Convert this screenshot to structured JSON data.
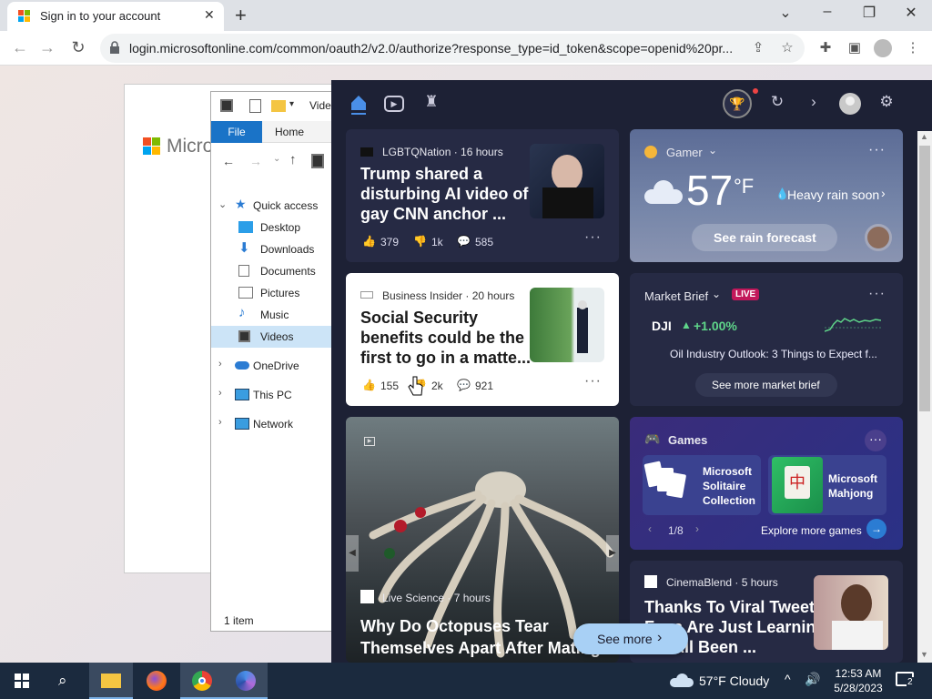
{
  "browser": {
    "tab_title": "Sign in to your account",
    "url": "login.microsoftonline.com/common/oauth2/v2.0/authorize?response_type=id_token&scope=openid%20pr..."
  },
  "ms_page": {
    "brand": "Microsoft"
  },
  "explorer": {
    "file_tab": "File",
    "home_tab": "Home",
    "title_partial": "Vide",
    "tree": [
      {
        "label": "Quick access"
      },
      {
        "label": "Desktop"
      },
      {
        "label": "Downloads"
      },
      {
        "label": "Documents"
      },
      {
        "label": "Pictures"
      },
      {
        "label": "Music"
      },
      {
        "label": "Videos"
      },
      {
        "label": "OneDrive"
      },
      {
        "label": "This PC"
      },
      {
        "label": "Network"
      }
    ],
    "status": "1 item"
  },
  "widgets": {
    "news1": {
      "source": "LGBTQNation · 16 hours",
      "headline": "Trump shared a disturbing AI video of gay CNN anchor ...",
      "likes": "379",
      "dislikes": "1k",
      "comments": "585"
    },
    "news2": {
      "source": "Business Insider · 20 hours",
      "headline": "Social Security benefits could be the first to go in a matte...",
      "likes": "155",
      "dislikes": "2k",
      "comments": "921"
    },
    "news3": {
      "source": "Live Science · 7 hours",
      "headline": "Why Do Octopuses Tear Themselves Apart After Mating?"
    },
    "news4": {
      "source": "CinemaBlend · 5 hours",
      "headline_l1": "Thanks To Viral Tweet,",
      "headline_l2": "Fans Are Just Learning",
      "headline_l3": "We All Been ..."
    },
    "weather": {
      "label": "Gamer",
      "temp": "57",
      "unit": "°F",
      "condition": "Heavy rain soon",
      "forecast_btn": "See rain forecast"
    },
    "market": {
      "title": "Market Brief",
      "badge": "LIVE",
      "ticker": "DJI",
      "change": "+1.00%",
      "story": "Oil Industry Outlook: 3 Things to Expect f...",
      "more_btn": "See more market brief"
    },
    "games": {
      "title": "Games",
      "game1": "Microsoft Solitaire Collection",
      "game2": "Microsoft Mahjong",
      "pager": "1/8",
      "explore": "Explore more games"
    },
    "see_more": "See more"
  },
  "taskbar": {
    "weather": "57°F  Cloudy",
    "time": "12:53 AM",
    "date": "5/28/2023",
    "notif_count": "2"
  },
  "colors": {
    "panel_bg": "#1d2135",
    "card_bg": "#262a44",
    "accent": "#4a8fe8",
    "live_badge": "#c2185b",
    "market_up": "#5fd68a"
  }
}
